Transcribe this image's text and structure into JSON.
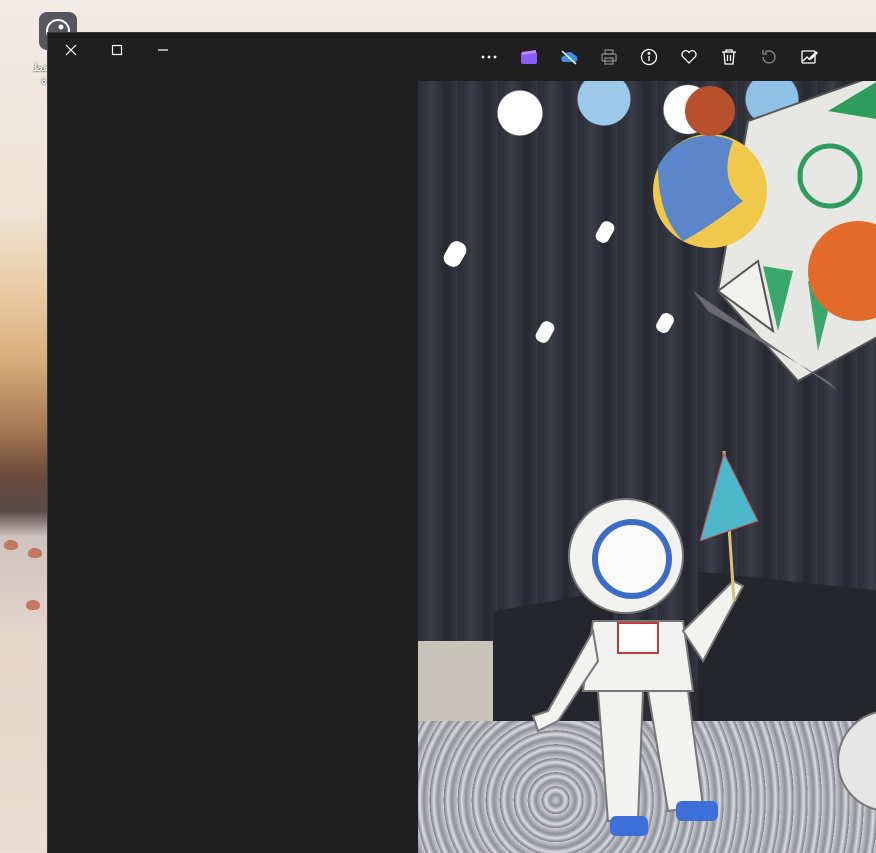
{
  "desktop": {
    "icon_name": "app-shortcut-icon",
    "icon_label": "حفظ\nة"
  },
  "window": {
    "controls": {
      "close_icon": "close-icon",
      "maximize_icon": "maximize-icon",
      "minimize_icon": "minimize-icon"
    },
    "toolbar": [
      {
        "name": "more-options-icon"
      },
      {
        "name": "clipchamp-icon"
      },
      {
        "name": "onedrive-icon"
      },
      {
        "name": "print-icon"
      },
      {
        "name": "info-icon"
      },
      {
        "name": "favorite-icon"
      },
      {
        "name": "delete-icon"
      },
      {
        "name": "rotate-icon"
      },
      {
        "name": "edit-image-icon"
      }
    ],
    "colors": {
      "background": "#1f1f1f",
      "clipchamp": "#8a5cf6",
      "onedrive": "#3b8fe8"
    }
  },
  "photo": {
    "description_icon": "photo-astronaut-scene"
  }
}
